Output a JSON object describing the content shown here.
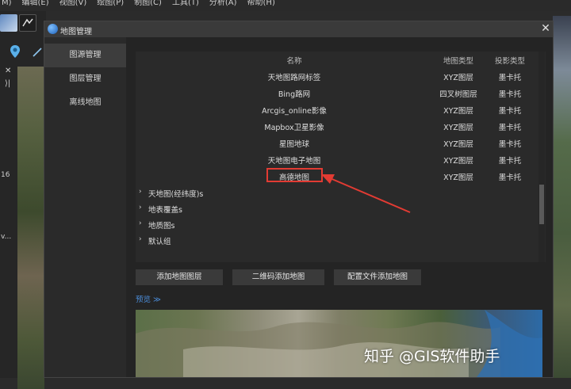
{
  "menubar": {
    "items": [
      "M)",
      "编辑(E)",
      "视图(V)",
      "绘图(P)",
      "制图(C)",
      "工具(T)",
      "分析(A)",
      "帮助(H)"
    ]
  },
  "host": {
    "side_labels": [
      "16",
      "v..."
    ]
  },
  "dialog": {
    "title": "地图管理",
    "close_glyph": "✕"
  },
  "nav": {
    "items": [
      "图源管理",
      "图层管理",
      "离线地图"
    ],
    "active_index": 0
  },
  "table": {
    "columns": [
      "名称",
      "地图类型",
      "投影类型"
    ],
    "rows": [
      {
        "name": "天地图路网标签",
        "type": "XYZ图层",
        "projection": "墨卡托"
      },
      {
        "name": "Bing路网",
        "type": "四叉树图层",
        "projection": "墨卡托"
      },
      {
        "name": "Arcgis_online影像",
        "type": "XYZ图层",
        "projection": "墨卡托"
      },
      {
        "name": "Mapbox卫星影像",
        "type": "XYZ图层",
        "projection": "墨卡托"
      },
      {
        "name": "星图地球",
        "type": "XYZ图层",
        "projection": "墨卡托"
      },
      {
        "name": "天地图电子地图",
        "type": "XYZ图层",
        "projection": "墨卡托"
      },
      {
        "name": "高德地图",
        "type": "XYZ图层",
        "projection": "墨卡托"
      }
    ],
    "highlighted_row": 6,
    "groups": [
      "天地图(经纬度)s",
      "地表覆盖s",
      "地质图s",
      "默认组"
    ]
  },
  "buttons": {
    "add_layer": "添加地图图层",
    "qr_add": "二维码添加地图",
    "config_add": "配置文件添加地图"
  },
  "preview": {
    "label": "预览 ≫"
  },
  "watermark": "知乎 @GIS软件助手",
  "colors": {
    "annotation_red": "#e23b33",
    "link_blue": "#4b8bd6"
  }
}
